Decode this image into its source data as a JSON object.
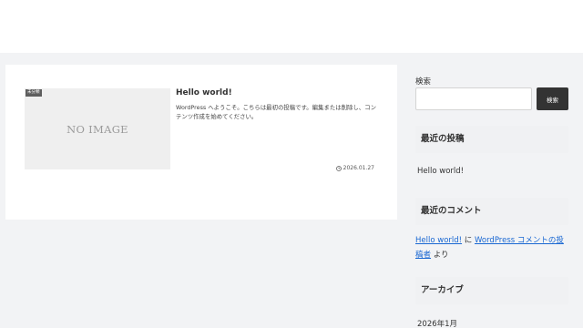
{
  "entry": {
    "category": "未分類",
    "thumb_text": "NO IMAGE",
    "title": "Hello world!",
    "snippet": "WordPress へようこそ。こちらは最初の投稿です。編集または削除し、コンテンツ作成を始めてください。",
    "date": "2026.01.27"
  },
  "sidebar": {
    "search": {
      "label": "検索",
      "value": "",
      "placeholder": "",
      "button_label": "検索"
    },
    "recent_posts": {
      "title": "最近の投稿",
      "items": [
        {
          "label": "Hello world!"
        }
      ]
    },
    "recent_comments": {
      "title": "最近のコメント",
      "post_link": "Hello world!",
      "connector": " に ",
      "author_link": "WordPress コメントの投稿者",
      "suffix": " より"
    },
    "archives": {
      "title": "アーカイブ",
      "items": [
        {
          "label": "2026年1月"
        }
      ]
    }
  },
  "colors": {
    "page_bg": "#f2f3f5",
    "card_bg": "#ffffff",
    "link": "#1967d2",
    "button_bg": "#333333",
    "widget_title_bg": "#f0f1f3"
  },
  "icons": {
    "date": "clock-icon"
  }
}
